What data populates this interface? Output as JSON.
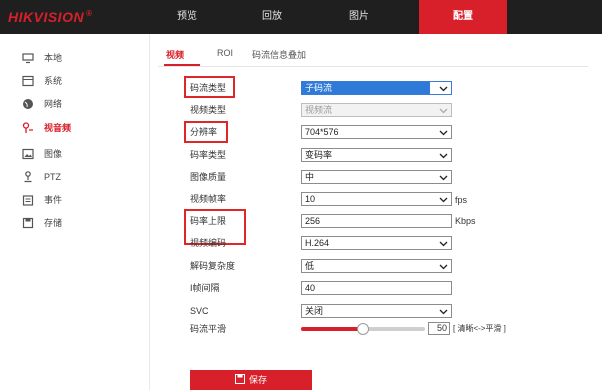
{
  "brand": {
    "logo_text": "HIKVISION",
    "registered_mark": "®",
    "accent_color": "#d7202a"
  },
  "top_nav": {
    "tabs": [
      {
        "label": "预览",
        "active": false
      },
      {
        "label": "回放",
        "active": false
      },
      {
        "label": "图片",
        "active": false
      },
      {
        "label": "配置",
        "active": true
      }
    ]
  },
  "sidebar": {
    "items": [
      {
        "label": "本地",
        "icon": "monitor-icon",
        "active": false
      },
      {
        "label": "系统",
        "icon": "system-icon",
        "active": false
      },
      {
        "label": "网络",
        "icon": "globe-icon",
        "active": false
      },
      {
        "label": "视音频",
        "icon": "audio-video-icon",
        "active": true
      },
      {
        "label": "图像",
        "icon": "image-icon",
        "active": false
      },
      {
        "label": "PTZ",
        "icon": "ptz-icon",
        "active": false
      },
      {
        "label": "事件",
        "icon": "calendar-icon",
        "active": false
      },
      {
        "label": "存储",
        "icon": "storage-icon",
        "active": false
      }
    ]
  },
  "sub_tabs": [
    {
      "label": "视频",
      "active": true
    },
    {
      "label": "ROI",
      "active": false
    },
    {
      "label": "码流信息叠加",
      "active": false
    }
  ],
  "form": {
    "stream_type": {
      "label": "码流类型",
      "value": "子码流",
      "highlighted": true
    },
    "video_type": {
      "label": "视频类型",
      "value": "视频流",
      "disabled": true
    },
    "resolution": {
      "label": "分辨率",
      "value": "704*576",
      "highlighted": true
    },
    "bitrate_type": {
      "label": "码率类型",
      "value": "变码率"
    },
    "image_quality": {
      "label": "图像质量",
      "value": "中"
    },
    "frame_rate": {
      "label": "视频帧率",
      "value": "10",
      "unit": "fps"
    },
    "bitrate_cap": {
      "label": "码率上限",
      "value": "256",
      "unit": "Kbps",
      "highlighted": true
    },
    "video_codec": {
      "label": "视频编码",
      "value": "H.264"
    },
    "decode_complexity": {
      "label": "解码复杂度",
      "value": "低"
    },
    "i_frame_interval": {
      "label": "I帧间隔",
      "value": "40"
    },
    "svc": {
      "label": "SVC",
      "value": "关闭"
    },
    "stream_smoothing": {
      "label": "码流平滑",
      "value": "50",
      "level": 0.5,
      "hint": "[ 清晰<->平滑 ]"
    }
  },
  "save_button": {
    "label": "保存",
    "icon": "save-icon"
  }
}
